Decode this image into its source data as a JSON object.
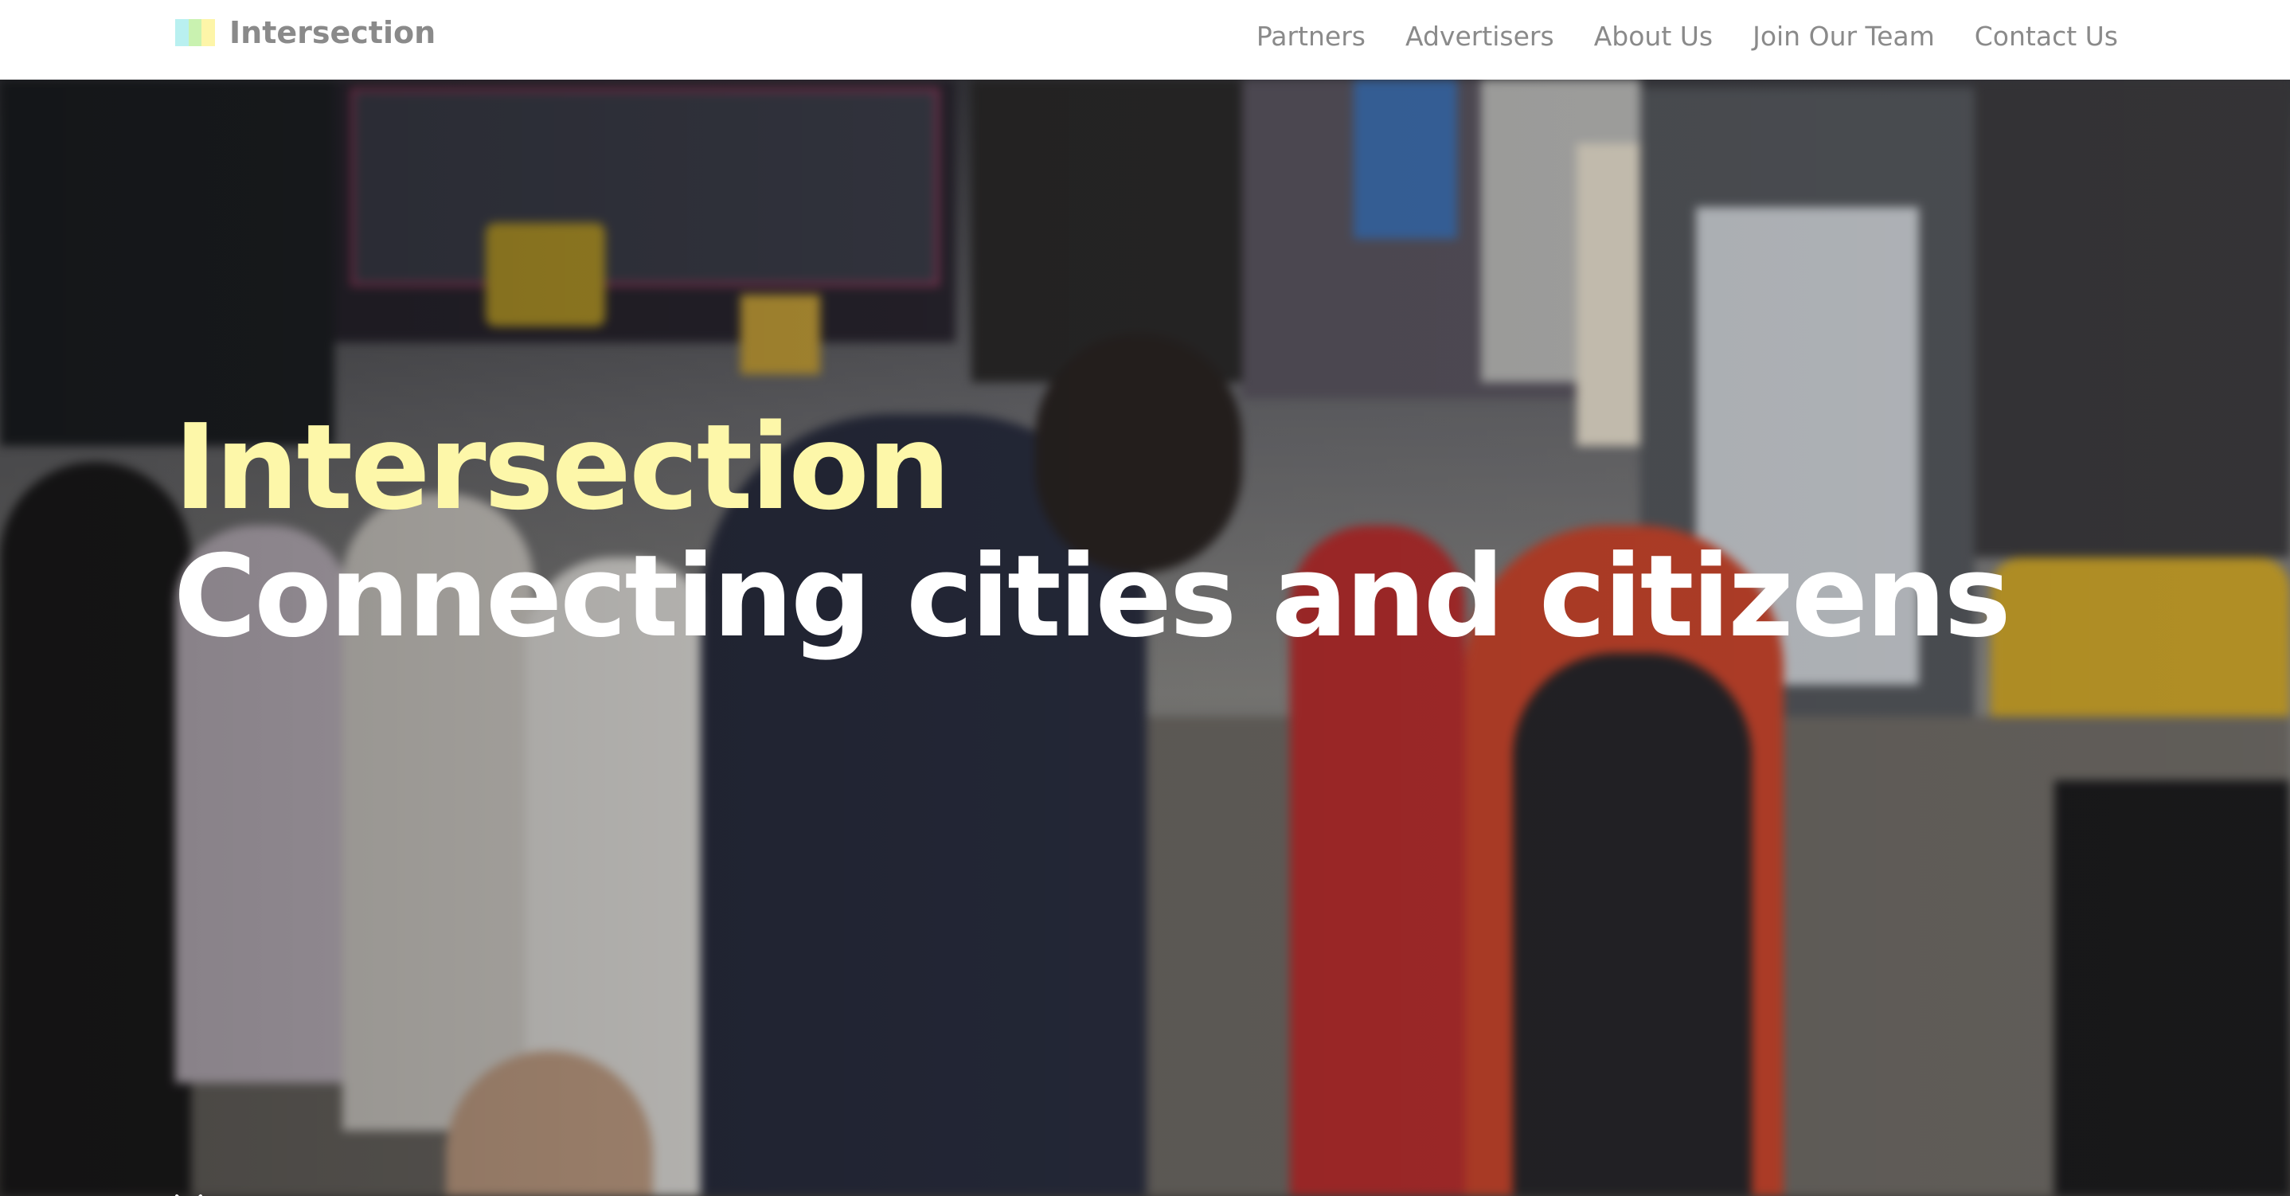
{
  "header": {
    "logo_text": "Intersection",
    "logo_colors": [
      "#b9f0f0",
      "#c9f2b0",
      "#fdf5a8"
    ],
    "nav": [
      {
        "label": "Partners"
      },
      {
        "label": "Advertisers"
      },
      {
        "label": "About Us"
      },
      {
        "label": "Join Our Team"
      },
      {
        "label": "Contact Us"
      }
    ]
  },
  "hero": {
    "title": "Intersection",
    "subtitle": "Connecting cities and citizens",
    "title_color": "#fdf7a9",
    "subtitle_color": "#ffffff",
    "background": "blurred-times-square-street-photo",
    "scroll_icon": "chevron-down-icon"
  }
}
